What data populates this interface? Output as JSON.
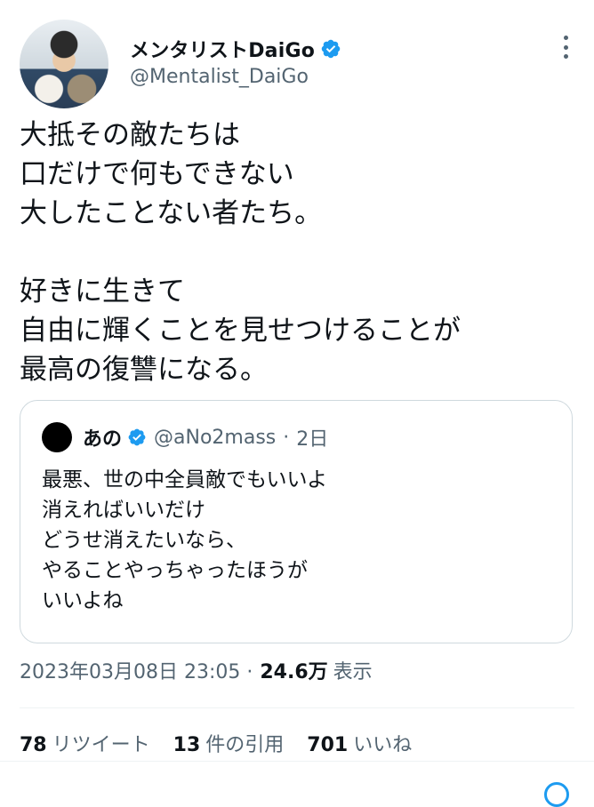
{
  "author": {
    "name": "メンタリストDaiGo",
    "handle": "@Mentalist_DaiGo",
    "verified": true,
    "avatar": "profile-photo-with-cats"
  },
  "tweet_text": "大抵その敵たちは\n口だけで何もできない\n大したことない者たち。\n\n好きに生きて\n自由に輝くことを見せつけることが\n最高の復讐になる。",
  "quoted": {
    "name": "あの",
    "handle": "@aNo2mass",
    "separator": "·",
    "time": "2日",
    "verified": true,
    "text": "最悪、世の中全員敵でもいいよ\n消えればいいだけ\nどうせ消えたいなら、\nやることやっちゃったほうが\nいいよね"
  },
  "meta": {
    "datetime": "2023年03月08日 23:05 ·",
    "views": "24.6万",
    "views_label": "表示"
  },
  "stats": {
    "retweets_count": "78",
    "retweets_label": "リツイート",
    "quotes_count": "13",
    "quotes_label": "件の引用",
    "likes_count": "701",
    "likes_label": "いいね"
  },
  "colors": {
    "verified_blue": "#1d9bf0",
    "secondary_text": "#536471",
    "border": "#cfd9de"
  }
}
